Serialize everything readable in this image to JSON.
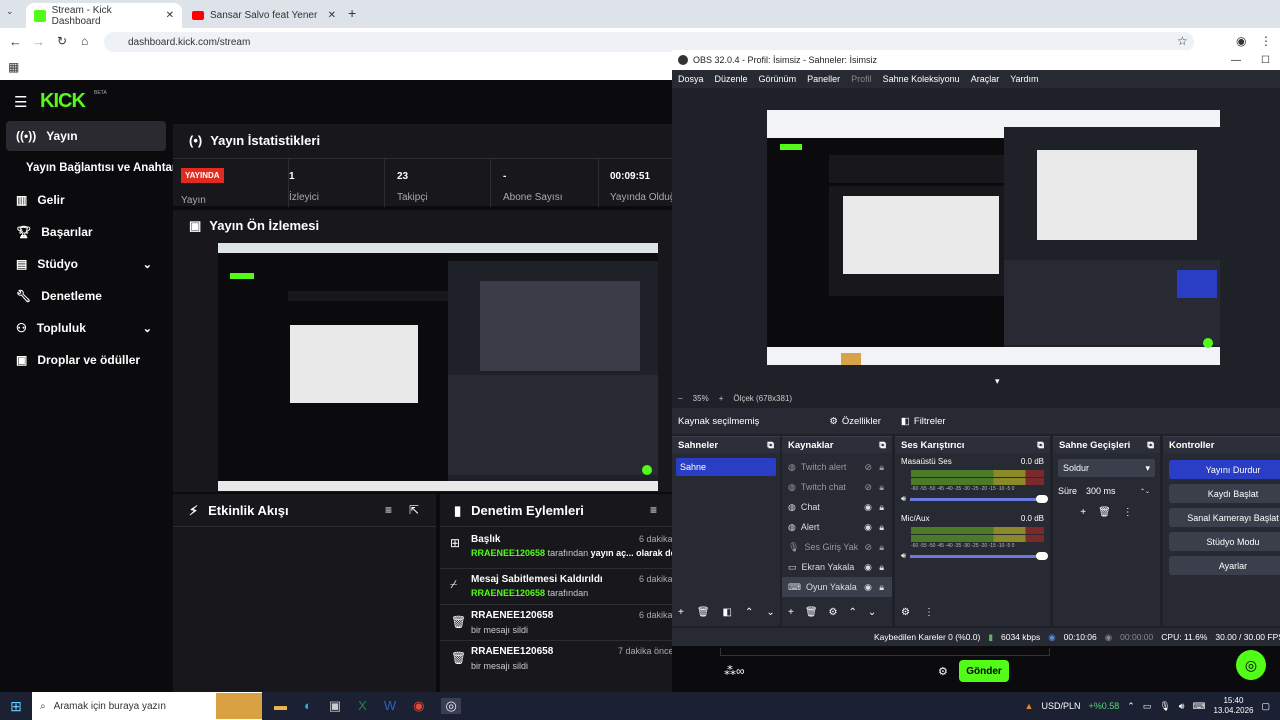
{
  "browser": {
    "tabs": [
      {
        "title": "Stream - Kick Dashboard",
        "active": true
      },
      {
        "title": "Sansar Salvo feat Yener - Gökyü",
        "active": false
      }
    ],
    "url": "dashboard.kick.com/stream"
  },
  "kick": {
    "logo": "KICK",
    "logo_sup": "BETA",
    "sidebar": [
      {
        "label": "Yayın",
        "icon": "broadcast-icon",
        "active": true
      },
      {
        "label": "Yayın Bağlantısı ve Anahtarı",
        "icon": "",
        "active": false
      },
      {
        "label": "Gelir",
        "icon": "chart-icon",
        "active": false
      },
      {
        "label": "Başarılar",
        "icon": "trophy-icon",
        "active": false
      },
      {
        "label": "Stüdyo",
        "icon": "studio-icon",
        "active": false,
        "expand": true
      },
      {
        "label": "Denetleme",
        "icon": "wrench-icon",
        "active": false
      },
      {
        "label": "Topluluk",
        "icon": "community-icon",
        "active": false,
        "expand": true
      },
      {
        "label": "Droplar ve ödüller",
        "icon": "gift-icon",
        "active": false
      }
    ],
    "stats_title": "Yayın İstatistikleri",
    "live_badge": "YAYINDA",
    "live_label": "Yayın",
    "stats": [
      {
        "value": "1",
        "label": "İzleyici"
      },
      {
        "value": "23",
        "label": "Takipçi"
      },
      {
        "value": "-",
        "label": "Abone Sayısı"
      },
      {
        "value": "00:09:51",
        "label": "Yayında Olduğ"
      }
    ],
    "preview_title": "Yayın Ön İzlemesi",
    "activity_title": "Etkinlik Akışı",
    "mod_title": "Denetim Eylemleri",
    "mod_actions": [
      {
        "title": "Başlık",
        "user": "RRAENEE120658",
        "desc_mid": "tarafından",
        "desc_rest": "yayın aç... olarak değiştirildi",
        "time": "6 dakika",
        "icon": "id-card-icon"
      },
      {
        "title": "Mesaj Sabitlemesi Kaldırıldı",
        "user": "RRAENEE120658",
        "desc_mid": "tarafından",
        "desc_rest": "",
        "time": "6 dakika",
        "icon": "unpin-icon"
      },
      {
        "title": "RRAENEE120658",
        "user": "",
        "desc_mid": "bir mesajı sildi",
        "desc_rest": "",
        "time": "6 dakika",
        "icon": "trash-icon"
      },
      {
        "title": "RRAENEE120658",
        "user": "",
        "desc_mid": "bir mesajı sildi",
        "desc_rest": "",
        "time": "7 dakika önce",
        "icon": "trash-icon"
      }
    ],
    "send_button": "Gönder"
  },
  "obs": {
    "title": "OBS 32.0.4 - Profil: İsimsiz - Sahneler: İsimsiz",
    "menu": [
      "Dosya",
      "Düzenle",
      "Görünüm",
      "Paneller",
      "Profil",
      "Sahne Koleksiyonu",
      "Araçlar",
      "Yardım"
    ],
    "zoom": "35%",
    "scale_label": "Ölçek (678x381)",
    "no_source": "Kaynak seçilmemiş",
    "properties": "Özellikler",
    "filters": "Filtreler",
    "scenes_title": "Sahneler",
    "scenes": [
      "Sahne"
    ],
    "sources_title": "Kaynaklar",
    "sources": [
      {
        "name": "Twitch alert",
        "visible": false
      },
      {
        "name": "Twitch chat",
        "visible": false
      },
      {
        "name": "Chat",
        "visible": true
      },
      {
        "name": "Alert",
        "visible": true
      },
      {
        "name": "Ses Giriş Yak",
        "visible": false
      },
      {
        "name": "Ekran Yakala",
        "visible": true
      },
      {
        "name": "Oyun Yakala",
        "visible": true
      }
    ],
    "mixer_title": "Ses Karıştırıcı",
    "mixer": [
      {
        "name": "Masaüstü Ses",
        "db": "0.0 dB"
      },
      {
        "name": "Mic/Aux",
        "db": "0.0 dB"
      }
    ],
    "meter_ticks": "-60 -55 -50 -45 -40 -35 -30 -25 -20 -15 -10 -5 0",
    "transitions_title": "Sahne Geçişleri",
    "transition": "Soldur",
    "duration_label": "Süre",
    "duration": "300 ms",
    "controls_title": "Kontroller",
    "controls": [
      "Yayını Durdur",
      "Kaydı Başlat",
      "Sanal Kamerayı Başlat",
      "Stüdyo Modu",
      "Ayarlar"
    ],
    "status": {
      "dropped": "Kaybedilen Kareler 0 (%0.0)",
      "bitrate": "6034 kbps",
      "live_time": "00:10:06",
      "rec_time": "00:00:00",
      "cpu": "CPU: 11.6%",
      "fps": "30.00 / 30.00 FPS"
    }
  },
  "taskbar": {
    "search": "Aramak için buraya yazın",
    "ticker": "USD/PLN",
    "ticker_change": "+%0.58",
    "time": "15:40",
    "date": "13.04.2026"
  },
  "colors": {
    "kick_green": "#53fc18",
    "live_red": "#e02b20",
    "obs_blue": "#2a3ec5"
  }
}
